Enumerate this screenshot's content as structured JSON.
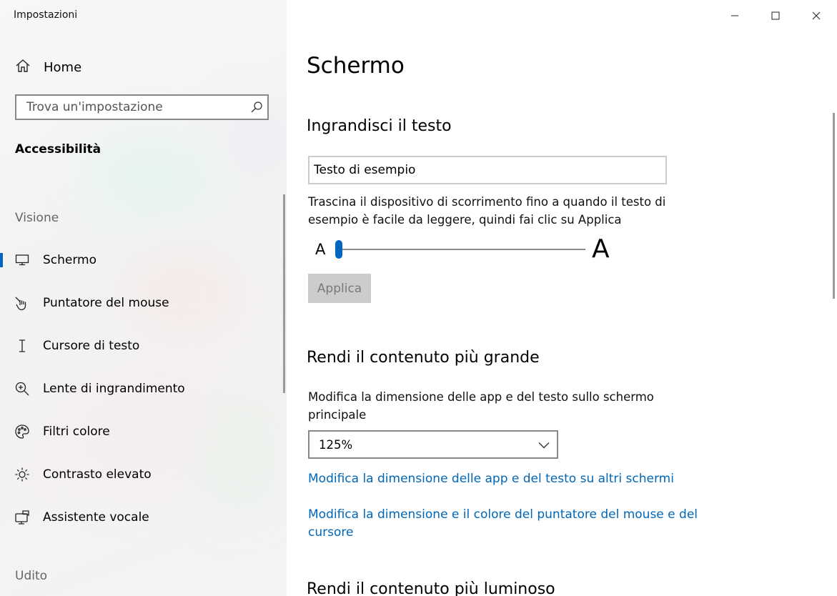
{
  "window": {
    "title": "Impostazioni",
    "controls": [
      "minimize-icon",
      "maximize-icon",
      "close-icon"
    ]
  },
  "sidebar": {
    "home_label": "Home",
    "search_placeholder": "Trova un'impostazione",
    "section_title": "Accessibilità",
    "groups": {
      "vision": "Visione",
      "hearing": "Udito"
    },
    "items": [
      {
        "label": "Schermo",
        "icon": "monitor-icon",
        "active": true
      },
      {
        "label": "Puntatore del mouse",
        "icon": "mouse-pointer-icon"
      },
      {
        "label": "Cursore di testo",
        "icon": "text-cursor-icon"
      },
      {
        "label": "Lente di ingrandimento",
        "icon": "magnifier-icon"
      },
      {
        "label": "Filtri colore",
        "icon": "palette-icon"
      },
      {
        "label": "Contrasto elevato",
        "icon": "brightness-icon"
      },
      {
        "label": "Assistente vocale",
        "icon": "narrator-icon"
      }
    ]
  },
  "main": {
    "title": "Schermo",
    "text_size": {
      "heading": "Ingrandisci il testo",
      "sample_text": "Testo di esempio",
      "description": "Trascina il dispositivo di scorrimento fino a quando il testo di esempio è facile da leggere, quindi fai clic su Applica",
      "slider_min_label": "A",
      "slider_max_label": "A",
      "slider_value": 0,
      "apply_label": "Applica"
    },
    "scale": {
      "heading": "Rendi il contenuto più grande",
      "description": "Modifica la dimensione delle app e del testo sullo schermo principale",
      "selected_value": "125%",
      "link_other_displays": "Modifica la dimensione delle app e del testo su altri schermi",
      "link_pointer": "Modifica la dimensione e il colore del puntatore del mouse e del cursore"
    },
    "brightness_heading": "Rendi il contenuto più luminoso"
  },
  "colors": {
    "accent": "#0067c0",
    "link": "#0067b8",
    "disabled_button": "#cccccc"
  }
}
